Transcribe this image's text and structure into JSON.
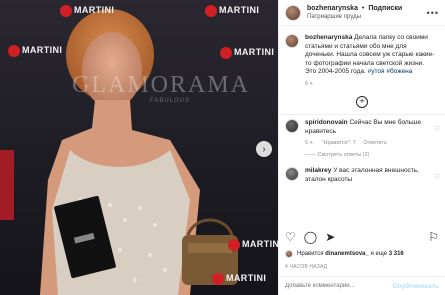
{
  "post": {
    "photo_text": {
      "brand": "MARTINI",
      "magazine": "GLAMORAMA",
      "magazine_sub": "FABULOUS"
    },
    "header": {
      "username": "bozhenarynska",
      "follow": "Подписки",
      "location": "Патриаршие пруды"
    },
    "caption": {
      "username": "bozhenarynska",
      "text": "Делала папку со своими статьями и статьями обо мне для доченьки. Нашла совсем уж старые какие-то фотографии начала светской жизни. Это 2004-2005 года.",
      "hashtags": "#утоя #божена",
      "time": "6 ч."
    },
    "comments": [
      {
        "username": "spiridonovain",
        "text": "Сейчас Вы мне больше нравитесь",
        "time": "6 ч.",
        "likes": "\"Нравится\": 7",
        "reply": "Ответить",
        "thread": "—— Смотреть ответы (2)"
      },
      {
        "username": "milakrey",
        "text": "У вас эталонная внешность, эталон красоты"
      }
    ],
    "likes": {
      "prefix": "Нравится",
      "user": "dinanemtsova_",
      "and": "и еще",
      "count": "3 316"
    },
    "timestamp": "4 ЧАСОВ НАЗАД",
    "comment_input": {
      "placeholder": "Добавьте комментарий...",
      "publish": "Опубликовать"
    }
  }
}
